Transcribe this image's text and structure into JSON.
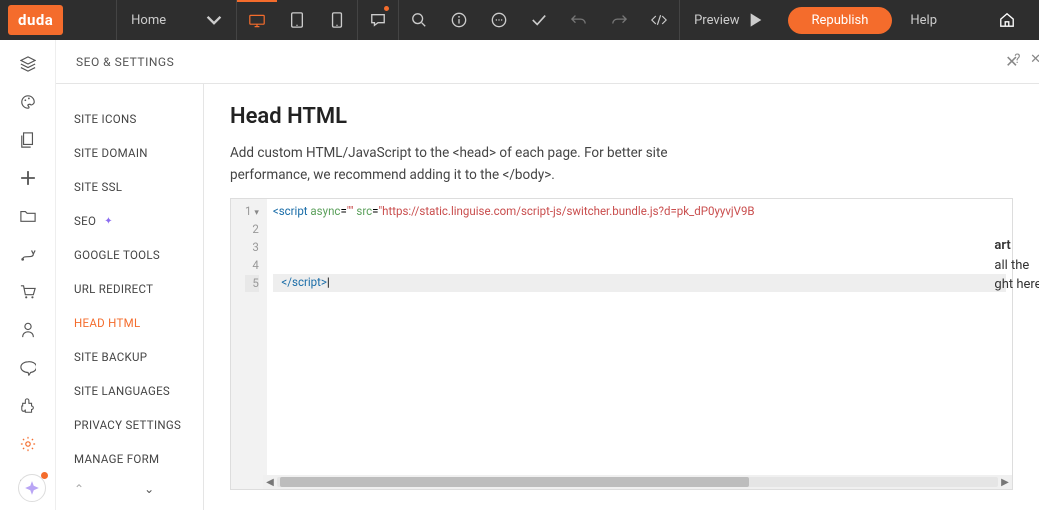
{
  "topbar": {
    "logo": "duda",
    "page_select": "Home",
    "preview": "Preview",
    "republish": "Republish",
    "help": "Help"
  },
  "panel": {
    "title": "SEO & SETTINGS"
  },
  "sidemenu": {
    "items": [
      {
        "label": "SITE ICONS"
      },
      {
        "label": "SITE DOMAIN"
      },
      {
        "label": "SITE SSL"
      },
      {
        "label": "SEO",
        "seo": true
      },
      {
        "label": "GOOGLE TOOLS"
      },
      {
        "label": "URL REDIRECT"
      },
      {
        "label": "HEAD HTML",
        "active": true
      },
      {
        "label": "SITE BACKUP"
      },
      {
        "label": "SITE LANGUAGES"
      },
      {
        "label": "PRIVACY SETTINGS"
      },
      {
        "label": "MANAGE FORM"
      }
    ]
  },
  "content": {
    "heading": "Head HTML",
    "description": "Add custom HTML/JavaScript to the <head> of each page. For better site performance, we recommend adding it to the </body>."
  },
  "editor": {
    "lines": [
      "1",
      "2",
      "3",
      "4",
      "5"
    ],
    "code_tag_open": "<script",
    "code_attr_async": " async",
    "code_eq1": "=",
    "code_val1": "\"\"",
    "code_attr_src": " src",
    "code_eq2": "=",
    "code_val2": "\"https://static.linguise.com/script-js/switcher.bundle.js?d=pk_dP0yyvjV9B",
    "code_close": "</script>",
    "cursor": "|"
  },
  "rs": {
    "hint_q": "?",
    "hint_x": "✕",
    "line1": "art",
    "line2": "all the",
    "line3": "ght here."
  }
}
